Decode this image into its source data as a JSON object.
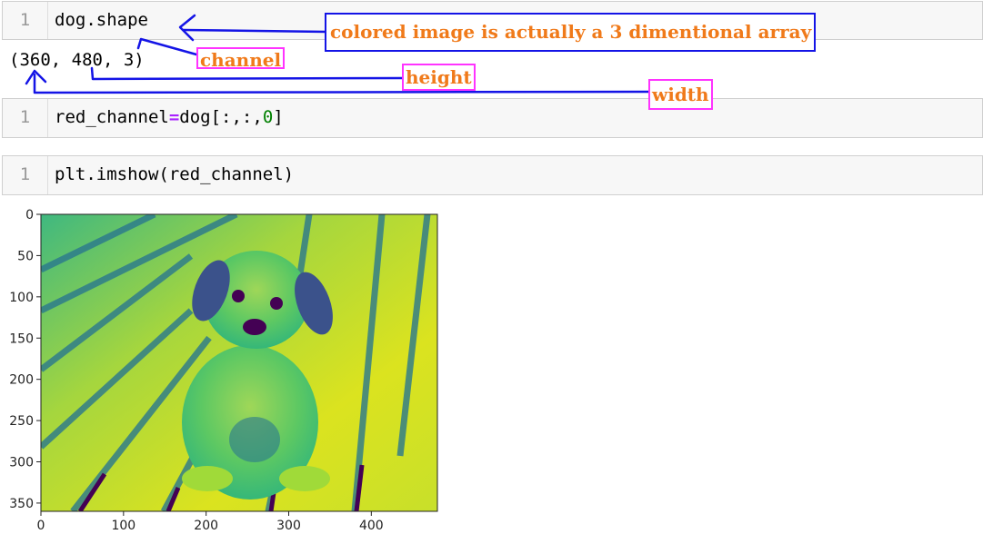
{
  "cells": [
    {
      "line_number": "1",
      "code": "dog.shape"
    },
    {
      "line_number": "1",
      "code_parts": [
        "red_channel",
        "=",
        "dog[:,:,",
        "0",
        "]"
      ]
    },
    {
      "line_number": "1",
      "code": "plt.imshow(red_channel)"
    }
  ],
  "output": {
    "shape_text": "(360, 480, 3)"
  },
  "annotations": {
    "main": "colored image is actually a 3 dimentional array",
    "channel": "channel",
    "height": "height",
    "width": "width"
  },
  "chart_data": {
    "type": "image",
    "image_description": "dog photograph rendered as single-channel heatmap (viridis)",
    "x_ticks": [
      "0",
      "100",
      "200",
      "300",
      "400"
    ],
    "y_ticks": [
      "0",
      "50",
      "100",
      "150",
      "200",
      "250",
      "300",
      "350"
    ],
    "xlim": [
      0,
      480
    ],
    "ylim": [
      360,
      0
    ],
    "colormap": "viridis"
  }
}
